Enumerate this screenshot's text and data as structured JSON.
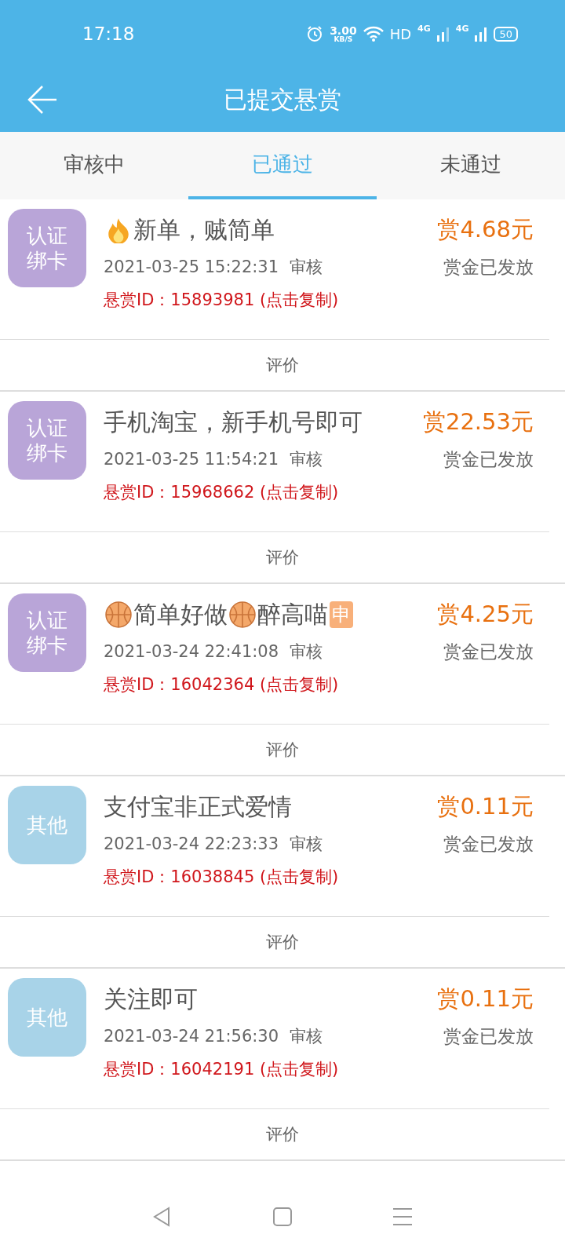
{
  "status_bar": {
    "time": "17:18",
    "speed_value": "3.00",
    "speed_unit": "KB/S",
    "hd": "HD",
    "network_1": "4G",
    "network_2": "4G",
    "battery": "50"
  },
  "header": {
    "title": "已提交悬赏"
  },
  "tabs": [
    {
      "label": "审核中",
      "selected": false
    },
    {
      "label": "已通过",
      "selected": true
    },
    {
      "label": "未通过",
      "selected": false
    }
  ],
  "items": [
    {
      "category": "认证绑卡",
      "color": "#b9a5d8",
      "title_parts": [
        {
          "kind": "flame"
        },
        {
          "kind": "text",
          "text": "新单，贼简单"
        }
      ],
      "reward": "赏4.68元",
      "time": "2021-03-25 15:22:31",
      "status": "审核",
      "payout": "赏金已发放",
      "reward_id": "悬赏ID：15893981 (点击复制)",
      "action": "评价"
    },
    {
      "category": "认证绑卡",
      "color": "#b9a5d8",
      "title_parts": [
        {
          "kind": "text",
          "text": "手机淘宝，新手机号即可"
        }
      ],
      "reward": "赏22.53元",
      "time": "2021-03-25 11:54:21",
      "status": "审核",
      "payout": "赏金已发放",
      "reward_id": "悬赏ID：15968662 (点击复制)",
      "action": "评价"
    },
    {
      "category": "认证绑卡",
      "color": "#b9a5d8",
      "title_parts": [
        {
          "kind": "ball"
        },
        {
          "kind": "text",
          "text": "简单好做"
        },
        {
          "kind": "ball"
        },
        {
          "kind": "text",
          "text": "醉高喵"
        },
        {
          "kind": "badge",
          "text": "申"
        }
      ],
      "reward": "赏4.25元",
      "time": "2021-03-24 22:41:08",
      "status": "审核",
      "payout": "赏金已发放",
      "reward_id": "悬赏ID：16042364 (点击复制)",
      "action": "评价"
    },
    {
      "category": "其他",
      "color": "#a8d3e8",
      "title_parts": [
        {
          "kind": "text",
          "text": "支付宝非正式爱情"
        }
      ],
      "reward": "赏0.11元",
      "time": "2021-03-24 22:23:33",
      "status": "审核",
      "payout": "赏金已发放",
      "reward_id": "悬赏ID：16038845 (点击复制)",
      "action": "评价"
    },
    {
      "category": "其他",
      "color": "#a8d3e8",
      "title_parts": [
        {
          "kind": "text",
          "text": "关注即可"
        }
      ],
      "reward": "赏0.11元",
      "time": "2021-03-24 21:56:30",
      "status": "审核",
      "payout": "赏金已发放",
      "reward_id": "悬赏ID：16042191 (点击复制)",
      "action": "评价"
    }
  ]
}
